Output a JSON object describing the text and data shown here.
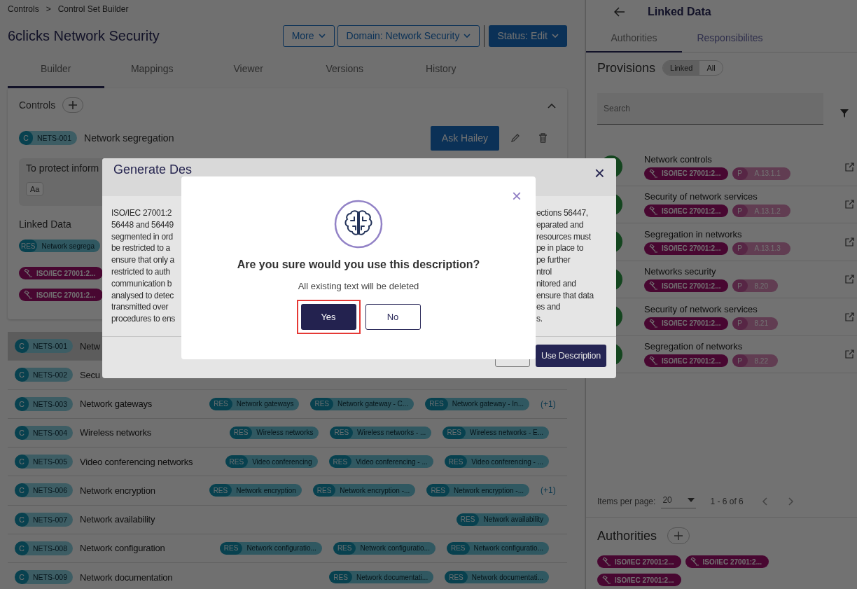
{
  "breadcrumb": {
    "items": [
      "Controls",
      "Control Set Builder"
    ],
    "separator": ">"
  },
  "page_title": "6clicks Network Security",
  "header_buttons": [
    {
      "label": "More",
      "kind": "outline"
    },
    {
      "label": "Domain: Network Security",
      "kind": "outline"
    },
    {
      "label": "Status: Edit",
      "kind": "primary"
    }
  ],
  "tabs": [
    {
      "label": "Builder",
      "selected": true
    },
    {
      "label": "Mappings",
      "selected": false
    },
    {
      "label": "Viewer",
      "selected": false
    },
    {
      "label": "Versions",
      "selected": false
    },
    {
      "label": "History",
      "selected": false
    }
  ],
  "controls_card": {
    "title": "Controls",
    "expanded": true,
    "editor": {
      "badge": "C",
      "code": "NETS-001",
      "name": "Network segregation",
      "ask_button": "Ask Hailey",
      "description": "To protect inform",
      "format_button": "Aa",
      "linked_title": "Linked Data",
      "responsibility": {
        "type": "RES",
        "label": "Network segrega"
      },
      "authorities": [
        "ISO/IEC 27001:2...",
        "ISO/IEC 27001:2..."
      ]
    }
  },
  "control_rows": [
    {
      "badge": "C",
      "code": "NETS-001",
      "name": "Netw",
      "selected": true,
      "chips": []
    },
    {
      "badge": "C",
      "code": "NETS-002",
      "name": "Secu",
      "selected": false,
      "chips": []
    },
    {
      "badge": "C",
      "code": "NETS-003",
      "name": "Network gateways",
      "selected": false,
      "chips": [
        {
          "type": "RES",
          "label": "Network gateways"
        },
        {
          "type": "RES",
          "label": "Network gateway - C..."
        },
        {
          "type": "RES",
          "label": "Network gateway - In..."
        }
      ],
      "more": "(+1)"
    },
    {
      "badge": "C",
      "code": "NETS-004",
      "name": "Wireless networks",
      "selected": false,
      "chips": [
        {
          "type": "RES",
          "label": "Wireless networks"
        },
        {
          "type": "RES",
          "label": "Wireless networks - ..."
        },
        {
          "type": "RES",
          "label": "Wireless networks - E..."
        }
      ]
    },
    {
      "badge": "C",
      "code": "NETS-005",
      "name": "Video conferencing networks",
      "selected": false,
      "chips": [
        {
          "type": "RES",
          "label": "Video conferencing"
        },
        {
          "type": "RES",
          "label": "Video conferencing - ..."
        },
        {
          "type": "RES",
          "label": "Video conferencing - ..."
        }
      ]
    },
    {
      "badge": "C",
      "code": "NETS-006",
      "name": "Network encryption",
      "selected": false,
      "chips": [
        {
          "type": "RES",
          "label": "Network encryption"
        },
        {
          "type": "RES",
          "label": "Network encryption -..."
        },
        {
          "type": "RES",
          "label": "Network encryption -..."
        }
      ],
      "more": "(+1)"
    },
    {
      "badge": "C",
      "code": "NETS-007",
      "name": "Network availability",
      "selected": false,
      "chips": [
        {
          "type": "RES",
          "label": "Network availability"
        }
      ]
    },
    {
      "badge": "C",
      "code": "NETS-008",
      "name": "Network configuration",
      "selected": false,
      "chips": [
        {
          "type": "RES",
          "label": "Network configuratio..."
        },
        {
          "type": "RES",
          "label": "Network configuratio..."
        },
        {
          "type": "RES",
          "label": "Network configuratio..."
        }
      ]
    },
    {
      "badge": "C",
      "code": "NETS-009",
      "name": "Network documentation",
      "selected": false,
      "chips": [
        {
          "type": "RES",
          "label": "Network documentati..."
        },
        {
          "type": "RES",
          "label": "Network documentati..."
        }
      ]
    }
  ],
  "linked_panel": {
    "title": "Linked Data",
    "tabs": [
      {
        "label": "Authorities",
        "selected": true
      },
      {
        "label": "Responsibilites",
        "selected": false
      }
    ],
    "provisions_title": "Provisions",
    "filter_toggle": [
      {
        "label": "Linked",
        "selected": true
      },
      {
        "label": "All",
        "selected": false
      }
    ],
    "search": {
      "placeholder": "Search"
    },
    "provisions": [
      {
        "name": "Network controls",
        "authority": "ISO/IEC 27001:2...",
        "badge": "P",
        "ref": "A.13.1.1"
      },
      {
        "name": "Security of network services",
        "authority": "ISO/IEC 27001:2...",
        "badge": "P",
        "ref": "A.13.1.2"
      },
      {
        "name": "Segregation in networks",
        "authority": "ISO/IEC 27001:2...",
        "badge": "P",
        "ref": "A.13.1.3"
      },
      {
        "name": "Networks security",
        "authority": "ISO/IEC 27001:2...",
        "badge": "P",
        "ref": "8.20"
      },
      {
        "name": "Security of network services",
        "authority": "ISO/IEC 27001:2...",
        "badge": "P",
        "ref": "8.21"
      },
      {
        "name": "Segregation of networks",
        "authority": "ISO/IEC 27001:2...",
        "badge": "P",
        "ref": "8.22"
      }
    ],
    "pagination": {
      "label": "Items per page:",
      "page_size": "20",
      "range": "1 - 6 of 6"
    },
    "authorities_title": "Authorities",
    "authorities": [
      "ISO/IEC 27001:2...",
      "ISO/IEC 27001:2...",
      "ISO/IEC 27001:2..."
    ]
  },
  "generate_modal": {
    "title": "Generate Des",
    "close": "×",
    "text_left": [
      "ISO/IEC 27001:2",
      "56448 and 56449",
      "segmented in ord",
      "be restricted to a",
      "ensure that only a",
      "restricted to auth",
      "communication b",
      "analysed to detec",
      "transmitted over",
      "procedures to ens"
    ],
    "text_right": [
      "ections 56447,",
      "eparated and",
      "resources must",
      "pe in place to",
      "pe further",
      "ntrol",
      "nitored and",
      "ensure that data",
      "es and",
      "s."
    ],
    "use_button": "Use Description"
  },
  "confirm_dialog": {
    "close": "×",
    "title": "Are you sure would you use this description?",
    "message": "All existing text will be deleted",
    "buttons": [
      {
        "label": "Yes",
        "kind": "primary",
        "focused": true
      },
      {
        "label": "No",
        "kind": "outline",
        "focused": false
      }
    ]
  }
}
